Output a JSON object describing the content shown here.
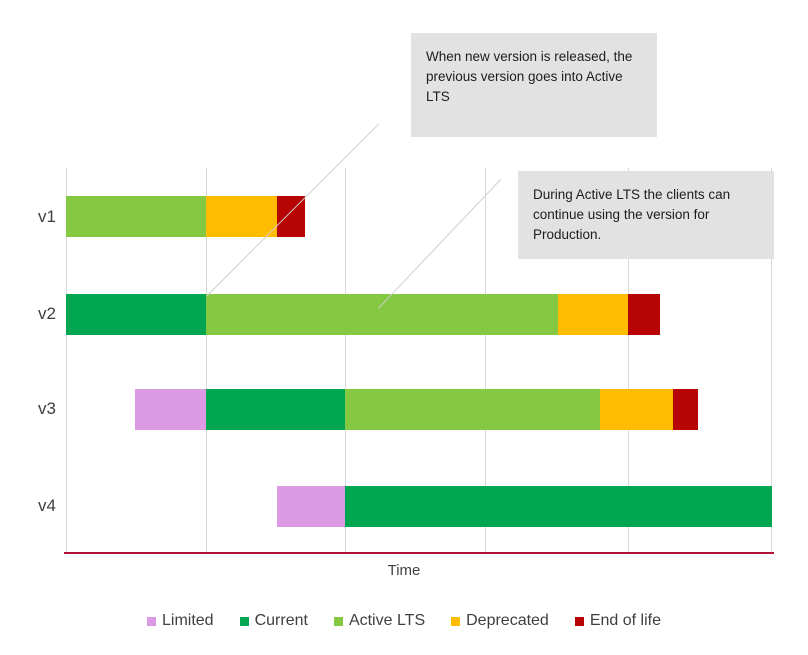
{
  "chart_data": {
    "type": "bar",
    "subtype": "stacked-horizontal-timeline",
    "title": "",
    "xlabel": "Time",
    "ylabel": "",
    "categories": [
      "v1",
      "v2",
      "v3",
      "v4"
    ],
    "legend": {
      "position": "bottom",
      "entries": [
        {
          "name": "Limited",
          "color": "#dc9ae5"
        },
        {
          "name": "Current",
          "color": "#00a650"
        },
        {
          "name": "Active LTS",
          "color": "#84c941"
        },
        {
          "name": "Deprecated",
          "color": "#ffbc00"
        },
        {
          "name": "End of life",
          "color": "#b70404"
        }
      ]
    },
    "axis": {
      "x_range": [
        0,
        6
      ],
      "gridline_positions": [
        0,
        1,
        2,
        3,
        4,
        5
      ],
      "grid": true,
      "baseline_color": "#b01235"
    },
    "series": [
      {
        "category": "v1",
        "segments": [
          {
            "name": "Active LTS",
            "start": 0.0,
            "end": 1.0,
            "color": "#84c941"
          },
          {
            "name": "Deprecated",
            "start": 1.0,
            "end": 1.5,
            "color": "#ffbc00"
          },
          {
            "name": "End of life",
            "start": 1.5,
            "end": 1.7,
            "color": "#b70404"
          }
        ]
      },
      {
        "category": "v2",
        "segments": [
          {
            "name": "Current",
            "start": 0.0,
            "end": 1.0,
            "color": "#00a650"
          },
          {
            "name": "Active LTS",
            "start": 1.0,
            "end": 3.5,
            "color": "#84c941"
          },
          {
            "name": "Deprecated",
            "start": 3.5,
            "end": 4.0,
            "color": "#ffbc00"
          },
          {
            "name": "End of life",
            "start": 4.0,
            "end": 4.23,
            "color": "#b70404"
          }
        ]
      },
      {
        "category": "v3",
        "segments": [
          {
            "name": "Limited",
            "start": 0.49,
            "end": 1.0,
            "color": "#dc9ae5"
          },
          {
            "name": "Current",
            "start": 1.0,
            "end": 2.0,
            "color": "#00a650"
          },
          {
            "name": "Active LTS",
            "start": 2.0,
            "end": 3.8,
            "color": "#84c941"
          },
          {
            "name": "Deprecated",
            "start": 3.8,
            "end": 4.32,
            "color": "#ffbc00"
          },
          {
            "name": "End of life",
            "start": 4.32,
            "end": 4.5,
            "color": "#b70404"
          }
        ]
      },
      {
        "category": "v4",
        "segments": [
          {
            "name": "Limited",
            "start": 1.5,
            "end": 2.0,
            "color": "#dc9ae5"
          },
          {
            "name": "Current",
            "start": 2.0,
            "end": 5.0,
            "color": "#00a650"
          }
        ]
      }
    ]
  },
  "callouts": [
    {
      "id": "callout-active-lts-transition",
      "text": "When new version is released, the previous version goes into Active LTS"
    },
    {
      "id": "callout-production-usage",
      "text": "During Active LTS the clients can continue using the version for Production."
    }
  ],
  "colors": {
    "limited": "#dc9ae5",
    "current": "#00a650",
    "active_lts": "#84c941",
    "deprecated": "#ffbc00",
    "end_of_life": "#b70404",
    "gridline": "#d9d9d9",
    "baseline": "#b01235",
    "callout_bg": "#e2e2e2",
    "text": "#3f3f3f"
  }
}
